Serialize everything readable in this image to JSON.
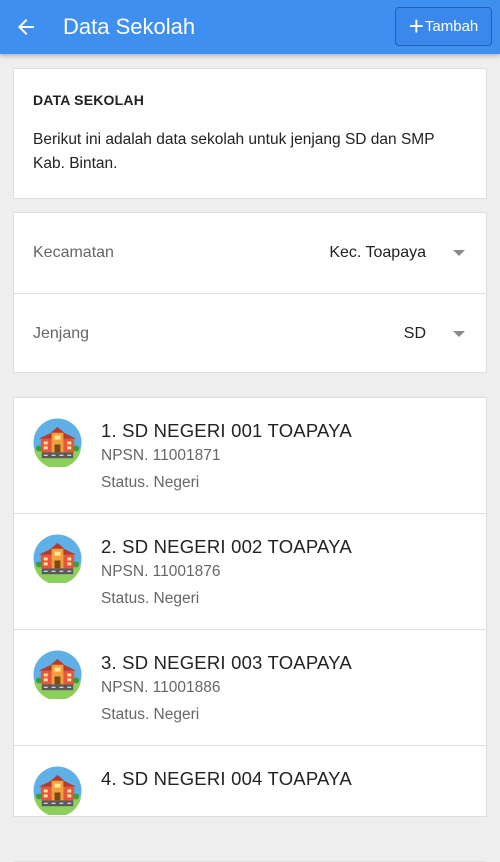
{
  "appbar": {
    "title": "Data Sekolah",
    "back_icon": "arrow-back-icon",
    "add_label": "Tambah",
    "color": "#3f8ff0"
  },
  "info": {
    "title": "DATA SEKOLAH",
    "description": "Berikut ini adalah data sekolah untuk jenjang SD dan SMP Kab. Bintan."
  },
  "filters": {
    "kecamatan": {
      "label": "Kecamatan",
      "value": "Kec. Toapaya"
    },
    "jenjang": {
      "label": "Jenjang",
      "value": "SD"
    }
  },
  "schools": [
    {
      "name": "1. SD NEGERI 001 TOAPAYA",
      "npsn": "NPSN. 11001871",
      "status": "Status. Negeri"
    },
    {
      "name": "2. SD NEGERI 002 TOAPAYA",
      "npsn": "NPSN. 11001876",
      "status": "Status. Negeri"
    },
    {
      "name": "3. SD NEGERI 003 TOAPAYA",
      "npsn": "NPSN. 11001886",
      "status": "Status. Negeri"
    },
    {
      "name": "4. SD NEGERI 004 TOAPAYA",
      "npsn": "",
      "status": ""
    }
  ]
}
